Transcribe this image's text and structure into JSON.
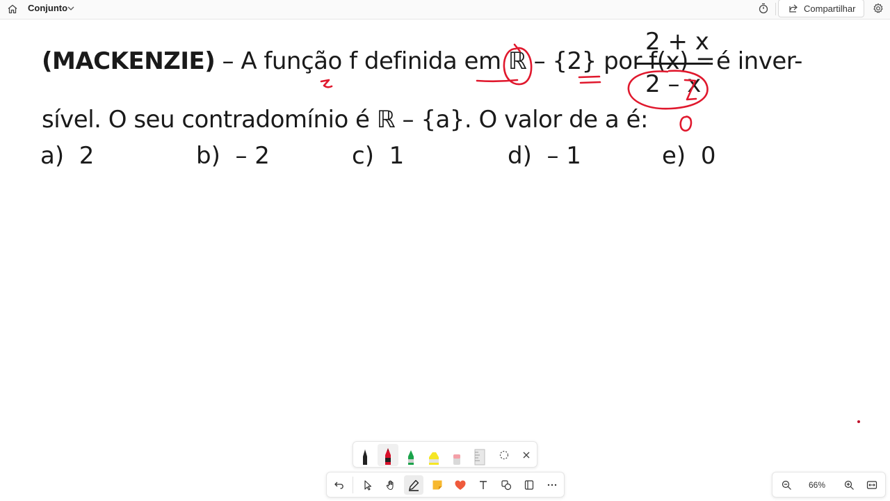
{
  "topbar": {
    "board_title": "Conjunto",
    "share_label": "Compartilhar",
    "icons": [
      "home-icon",
      "chevron-down-icon",
      "timer-icon",
      "share-icon",
      "settings-icon"
    ]
  },
  "content": {
    "line1_source": "(MACKENZIE)",
    "line1_text": " – A função f definida em ℝ – {2} por f(x) =",
    "fraction_numerator": "2 + x",
    "fraction_denominator": "2 – x",
    "line1_end": "é inver-",
    "line2_text": "sível. O seu contradomínio é ℝ – {a}. O valor de a é:",
    "options": [
      {
        "letter": "a)",
        "value": "2"
      },
      {
        "letter": "b)",
        "value": "– 2"
      },
      {
        "letter": "c)",
        "value": "1"
      },
      {
        "letter": "d)",
        "value": "– 1"
      },
      {
        "letter": "e)",
        "value": "0"
      }
    ],
    "handwritten_note": "0"
  },
  "ink_color": "#e0182d",
  "pen_palette": {
    "pens": [
      {
        "name": "black-pen",
        "color": "#222222"
      },
      {
        "name": "red-pen",
        "color": "#d8102a",
        "selected": true
      },
      {
        "name": "green-pen",
        "color": "#1aa34a"
      },
      {
        "name": "yellow-highlighter",
        "color": "#f5e625"
      },
      {
        "name": "eraser",
        "color": "#f4a0a8"
      },
      {
        "name": "ruler",
        "color": "#bdbdbd"
      }
    ],
    "icons": [
      "lasso-icon",
      "close-icon"
    ]
  },
  "toolbar": {
    "icons": [
      "undo-icon",
      "select-icon",
      "hand-icon",
      "pen-icon",
      "sticky-note-icon",
      "reaction-icon",
      "text-icon",
      "shapes-icon",
      "template-icon",
      "more-icon"
    ],
    "selected": "pen-icon"
  },
  "zoom": {
    "level": "66%",
    "icons": [
      "zoom-out-icon",
      "zoom-in-icon",
      "fit-to-screen-icon"
    ]
  }
}
